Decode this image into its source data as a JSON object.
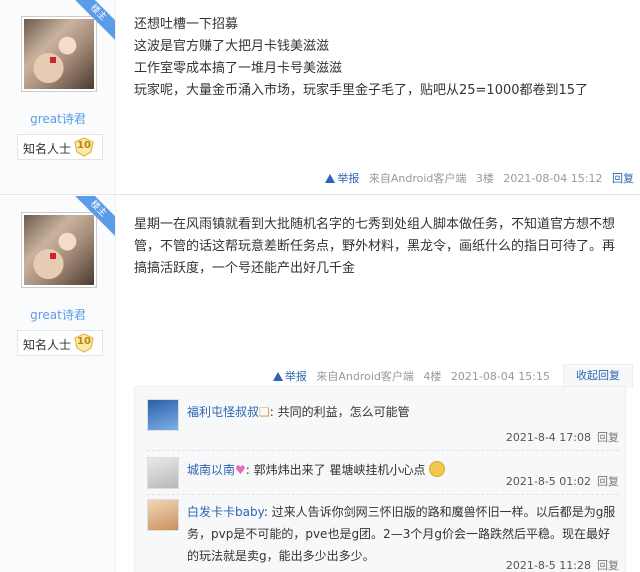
{
  "posts": [
    {
      "badge": "楼主",
      "username": "great诗君",
      "rank_title": "知名人士",
      "level": "10",
      "lines": [
        "还想吐槽一下招募",
        "这波是官方赚了大把月卡钱美滋滋",
        "工作室零成本搞了一堆月卡号美滋滋",
        "玩家呢，大量金币涌入市场，玩家手里金子毛了，贴吧从25=1000都卷到15了"
      ],
      "report": "举报",
      "source": "来自Android客户端",
      "floor": "3楼",
      "time": "2021-08-04 15:12",
      "reply": "回复"
    },
    {
      "badge": "楼主",
      "username": "great诗君",
      "rank_title": "知名人士",
      "level": "10",
      "text": "星期一在风雨镇就看到大批随机名字的七秀到处组人脚本做任务，不知道官方想不想管，不管的话这帮玩意差断任务点，野外材料，黑龙令，画纸什么的指日可待了。再搞搞活跃度，一个号还能产出好几千金",
      "report": "举报",
      "source": "来自Android客户端",
      "floor": "4楼",
      "time": "2021-08-04 15:15",
      "fold": "收起回复"
    }
  ],
  "replies": [
    {
      "user": "福利屯怪叔叔",
      "text": ": 共同的利益，怎么可能管",
      "time": "2021-8-4 17:08",
      "reply": "回复"
    },
    {
      "user": "城南以南",
      "text": ": 郭炜炜出来了 瞿塘峡挂机小心点",
      "time": "2021-8-5 01:02",
      "reply": "回复"
    },
    {
      "user": "白发卡卡baby",
      "text": ": 过来人告诉你剑网三怀旧版的路和魔兽怀旧一样。以后都是为g服务，pvp是不可能的，pve也是g团。2—3个月g价会一路跌然后平稳。现在最好的玩法就是卖g，能出多少出多少。",
      "time": "2021-8-5 11:28",
      "reply": "回复"
    }
  ],
  "colors": {
    "link": "#2d64b3",
    "username": "#5b9ce8",
    "badge": "#5b9ce8"
  }
}
